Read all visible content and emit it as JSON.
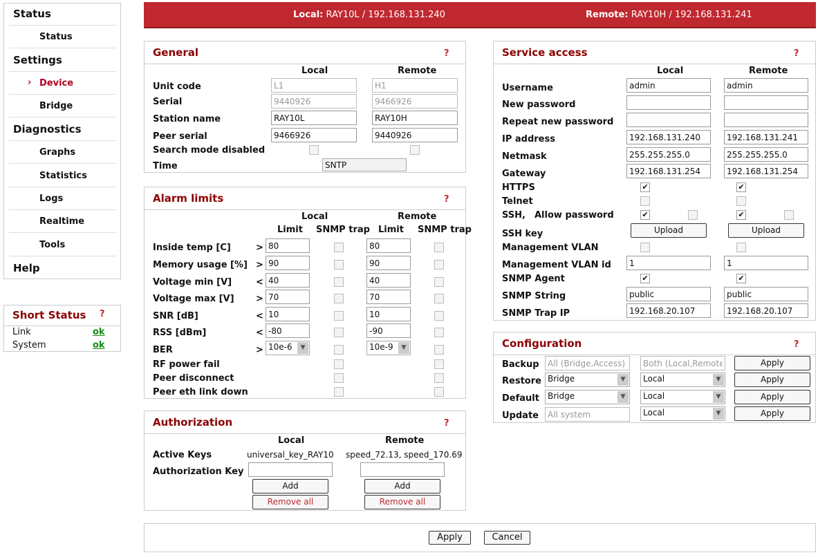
{
  "sidebar": {
    "status_header": "Status",
    "status_item": "Status",
    "settings_header": "Settings",
    "device_item": "Device",
    "bridge_item": "Bridge",
    "diagnostics_header": "Diagnostics",
    "graphs_item": "Graphs",
    "statistics_item": "Statistics",
    "logs_item": "Logs",
    "realtime_item": "Realtime",
    "tools_item": "Tools",
    "help_header": "Help",
    "active_marker": "›"
  },
  "short_status": {
    "title": "Short Status",
    "help": "?",
    "link_label": "Link",
    "link_value": "ok",
    "system_label": "System",
    "system_value": "ok"
  },
  "topbar": {
    "local_label": "Local:",
    "local_value": "RAY10L / 192.168.131.240",
    "remote_label": "Remote:",
    "remote_value": "RAY10H / 192.168.131.241"
  },
  "general": {
    "title": "General",
    "help": "?",
    "local_header": "Local",
    "remote_header": "Remote",
    "unit_code_label": "Unit code",
    "unit_code_local": "L1",
    "unit_code_remote": "H1",
    "serial_label": "Serial",
    "serial_local": "9440926",
    "serial_remote": "9466926",
    "station_name_label": "Station name",
    "station_name_local": "RAY10L",
    "station_name_remote": "RAY10H",
    "peer_serial_label": "Peer serial",
    "peer_serial_local": "9466926",
    "peer_serial_remote": "9440926",
    "search_mode_label": "Search mode disabled",
    "time_label": "Time",
    "time_value": "SNTP"
  },
  "alarm": {
    "title": "Alarm limits",
    "help": "?",
    "local_header": "Local",
    "remote_header": "Remote",
    "limit_header": "Limit",
    "snmp_header": "SNMP trap",
    "rows": [
      {
        "label": "Inside temp [C]",
        "op": ">",
        "local": "80",
        "remote": "80"
      },
      {
        "label": "Memory usage [%]",
        "op": ">",
        "local": "90",
        "remote": "90"
      },
      {
        "label": "Voltage min [V]",
        "op": "<",
        "local": "40",
        "remote": "40"
      },
      {
        "label": "Voltage max [V]",
        "op": ">",
        "local": "70",
        "remote": "70"
      },
      {
        "label": "SNR [dB]",
        "op": "<",
        "local": "10",
        "remote": "10"
      },
      {
        "label": "RSS [dBm]",
        "op": "<",
        "local": "-80",
        "remote": "-90"
      }
    ],
    "ber_label": "BER",
    "ber_op": ">",
    "ber_local": "10e-6",
    "ber_remote": "10e-9",
    "rf_label": "RF power fail",
    "peer_disconnect_label": "Peer disconnect",
    "peer_eth_label": "Peer eth link down"
  },
  "auth": {
    "title": "Authorization",
    "help": "?",
    "local_header": "Local",
    "remote_header": "Remote",
    "active_keys_label": "Active Keys",
    "active_keys_local": "universal_key_RAY10",
    "active_keys_remote": "speed_72.13, speed_170.69",
    "auth_key_label": "Authorization Key",
    "add_label": "Add",
    "remove_all_label": "Remove all"
  },
  "service": {
    "title": "Service access",
    "help": "?",
    "local_header": "Local",
    "remote_header": "Remote",
    "username_label": "Username",
    "username_local": "admin",
    "username_remote": "admin",
    "new_password_label": "New password",
    "repeat_password_label": "Repeat new password",
    "ip_label": "IP address",
    "ip_local": "192.168.131.240",
    "ip_remote": "192.168.131.241",
    "netmask_label": "Netmask",
    "netmask_local": "255.255.255.0",
    "netmask_remote": "255.255.255.0",
    "gateway_label": "Gateway",
    "gateway_local": "192.168.131.254",
    "gateway_remote": "192.168.131.254",
    "https_label": "HTTPS",
    "telnet_label": "Telnet",
    "ssh_label": "SSH,",
    "allow_password_label": "Allow password",
    "ssh_key_label": "SSH key",
    "upload_label": "Upload",
    "mgmt_vlan_label": "Management VLAN",
    "mgmt_vlan_id_label": "Management VLAN id",
    "mgmt_vlan_id_local": "1",
    "mgmt_vlan_id_remote": "1",
    "snmp_agent_label": "SNMP Agent",
    "snmp_string_label": "SNMP String",
    "snmp_string_local": "public",
    "snmp_string_remote": "public",
    "snmp_trap_label": "SNMP Trap IP",
    "snmp_trap_local": "192.168.20.107",
    "snmp_trap_remote": "192.168.20.107",
    "check_mark": "✔"
  },
  "config": {
    "title": "Configuration",
    "help": "?",
    "backup_label": "Backup",
    "backup_what": "All (Bridge,Access)",
    "backup_where": "Both (Local,Remote)",
    "restore_label": "Restore",
    "restore_what": "Bridge",
    "restore_where": "Local",
    "default_label": "Default",
    "default_what": "Bridge",
    "default_where": "Local",
    "update_label": "Update",
    "update_what": "All system",
    "update_where": "Local",
    "apply_label": "Apply",
    "dropdown_arrow": "▼"
  },
  "footer": {
    "apply_label": "Apply",
    "cancel_label": "Cancel"
  }
}
